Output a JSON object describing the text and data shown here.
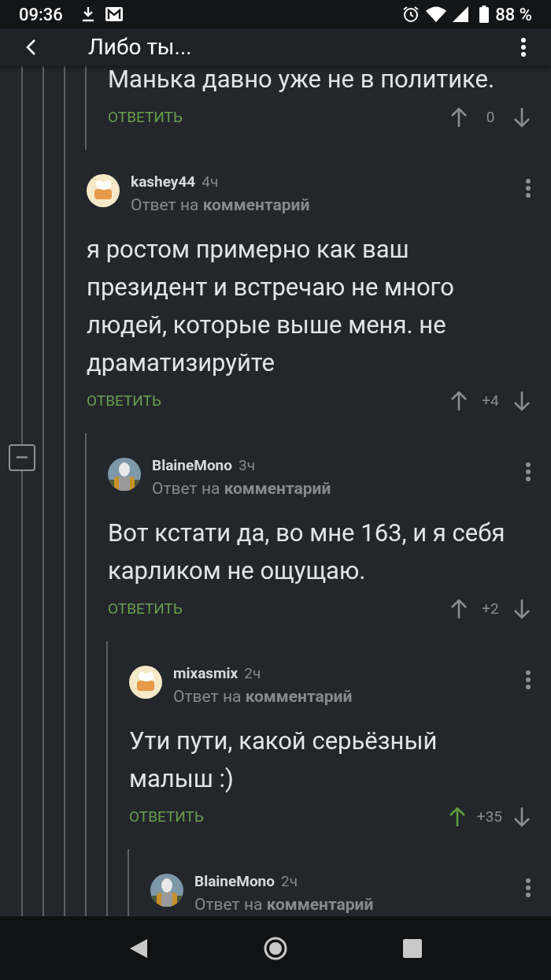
{
  "status_bar": {
    "time": "09:36",
    "battery": "88 %"
  },
  "app_bar": {
    "title": "Либо ты..."
  },
  "thread": [
    {
      "kind": "offscreen",
      "children": [
        {
          "kind": "comment",
          "text": "Манька давно уже не в политике.",
          "reply_label": "ОТВЕТИТЬ",
          "score": "0",
          "voted_up": false
        }
      ]
    },
    {
      "kind": "comment",
      "author": "kashey44",
      "time": "4ч",
      "avatar": {
        "kind": "toaster"
      },
      "reply_to": "Ответ на **комментарий**",
      "text": "я ростом примерно как ваш президент и встречаю не много людей, которые выше меня. не драматизируйте",
      "reply_label": "ОТВЕТИТЬ",
      "score": "+4",
      "voted_up": false,
      "children": [
        {
          "kind": "comment",
          "author": "BlaineMono",
          "time": "3ч",
          "avatar": {
            "kind": "photo"
          },
          "collapse_button": {
            "expanded": true
          },
          "reply_to": "Ответ на **комментарий**",
          "text": "Вот кстати да, во мне 163, и я себя карликом не ощущаю.",
          "reply_label": "ОТВЕТИТЬ",
          "score": "+2",
          "voted_up": false,
          "children": [
            {
              "kind": "comment",
              "author": "mixasmix",
              "time": "2ч",
              "avatar": {
                "kind": "toaster"
              },
              "reply_to": "Ответ на **комментарий**",
              "text": "Ути пути, какой серьёзный малыш :)",
              "reply_label": "ОТВЕТИТЬ",
              "score": "+35",
              "voted_up": true,
              "children": [
                {
                  "kind": "comment",
                  "author": "BlaineMono",
                  "time": "2ч",
                  "avatar": {
                    "kind": "photo"
                  },
                  "reply_to": "Ответ на **комментарий**"
                }
              ]
            }
          ]
        }
      ]
    }
  ]
}
